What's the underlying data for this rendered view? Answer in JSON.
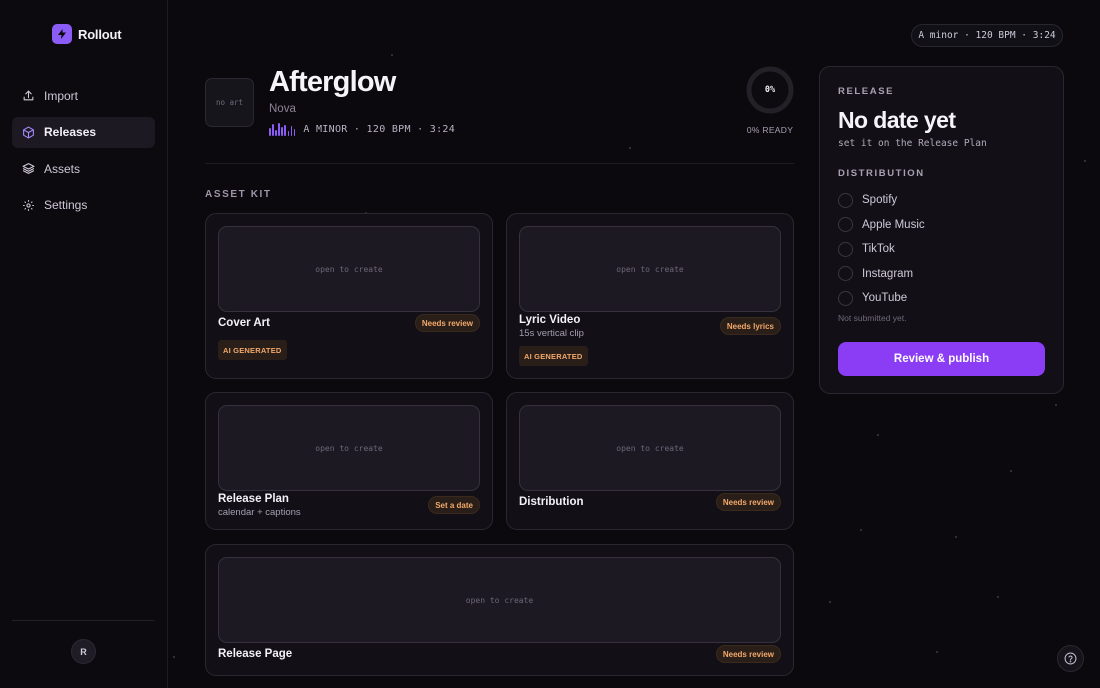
{
  "app": {
    "name": "Rollout"
  },
  "sidebar": {
    "items": [
      {
        "label": "Import",
        "icon": "upload-icon",
        "active": false
      },
      {
        "label": "Releases",
        "icon": "package-icon",
        "active": true
      },
      {
        "label": "Assets",
        "icon": "layers-icon",
        "active": false
      },
      {
        "label": "Settings",
        "icon": "gear-icon",
        "active": false
      }
    ],
    "avatar_initial": "R"
  },
  "top_pill": {
    "text": "A minor · 120 BPM · 3:24"
  },
  "release": {
    "art_placeholder": "no art",
    "title": "Afterglow",
    "artist": "Nova",
    "meta": "A MINOR · 120 BPM · 3:24",
    "progress_percent": 0,
    "progress_label": "0%",
    "ready_label": "0% READY"
  },
  "asset_kit": {
    "title": "ASSET KIT",
    "cards": [
      {
        "title": "Cover Art",
        "subtitle": "",
        "status": "Needs review",
        "ai_label": "AI GENERATED",
        "preview": "open to create"
      },
      {
        "title": "Lyric Video",
        "subtitle": "15s vertical clip",
        "status": "Needs lyrics",
        "ai_label": "AI GENERATED",
        "preview": "open to create"
      },
      {
        "title": "Release Plan",
        "subtitle": "calendar + captions",
        "status": "Set a date",
        "ai_label": "",
        "preview": "open to create"
      },
      {
        "title": "Distribution",
        "subtitle": "",
        "status": "Needs review",
        "ai_label": "",
        "preview": "open to create"
      },
      {
        "title": "Release Page",
        "subtitle": "",
        "status": "Needs review",
        "ai_label": "",
        "preview": "open to create"
      }
    ]
  },
  "panel": {
    "release_label": "RELEASE",
    "date": "No date yet",
    "date_hint": "set it on the Release Plan",
    "distribution_label": "DISTRIBUTION",
    "platforms": [
      "Spotify",
      "Apple Music",
      "TikTok",
      "Instagram",
      "YouTube"
    ],
    "submission_status": "Not submitted yet.",
    "publish_label": "Review & publish"
  },
  "colors": {
    "accent": "#8b5cf6",
    "button": "#8b3cf5",
    "badge_text": "#f2a86b",
    "background": "#0b090e"
  }
}
